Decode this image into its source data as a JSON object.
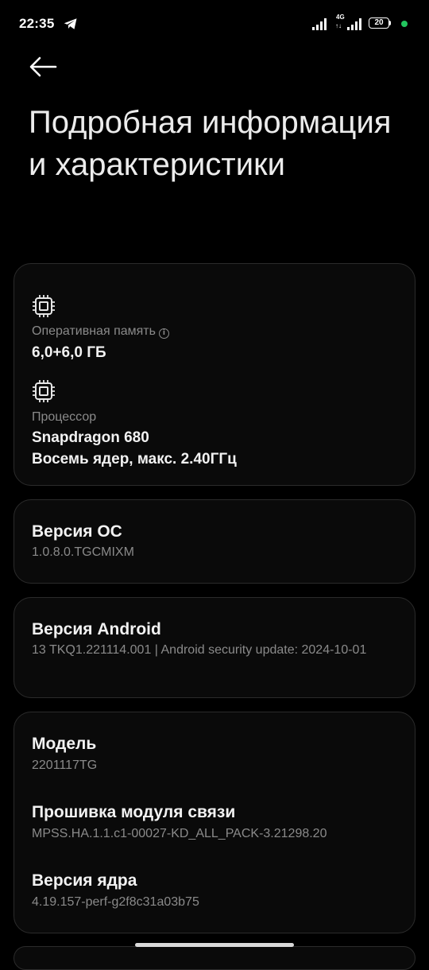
{
  "status_bar": {
    "time": "22:35",
    "network": "4G",
    "network_arrows": "↑↓",
    "battery": "20",
    "telegram_icon": "telegram-icon",
    "dot_color": "#22c55e"
  },
  "header": {
    "back_icon": "arrow-left-icon",
    "title": "Подробная информация и характеристики"
  },
  "specs": {
    "ram_label": "Оперативная память",
    "ram_info_icon": "i",
    "ram_value": "6,0+6,0 ГБ",
    "cpu_label": "Процессор",
    "cpu_value_1": "Snapdragon 680",
    "cpu_value_2": "Восемь ядер, макс. 2.40ГГц"
  },
  "os_version": {
    "title": "Версия ОС",
    "value": "1.0.8.0.TGCMIXM"
  },
  "android_version": {
    "title": "Версия Android",
    "value": "13 TKQ1.221114.001 | Android security update: 2024-10-01"
  },
  "device": {
    "model_title": "Модель",
    "model_value": "2201117TG",
    "baseband_title": "Прошивка модуля связи",
    "baseband_value": "MPSS.HA.1.1.c1-00027-KD_ALL_PACK-3.21298.20",
    "kernel_title": "Версия ядра",
    "kernel_value": "4.19.157-perf-g2f8c31a03b75"
  }
}
